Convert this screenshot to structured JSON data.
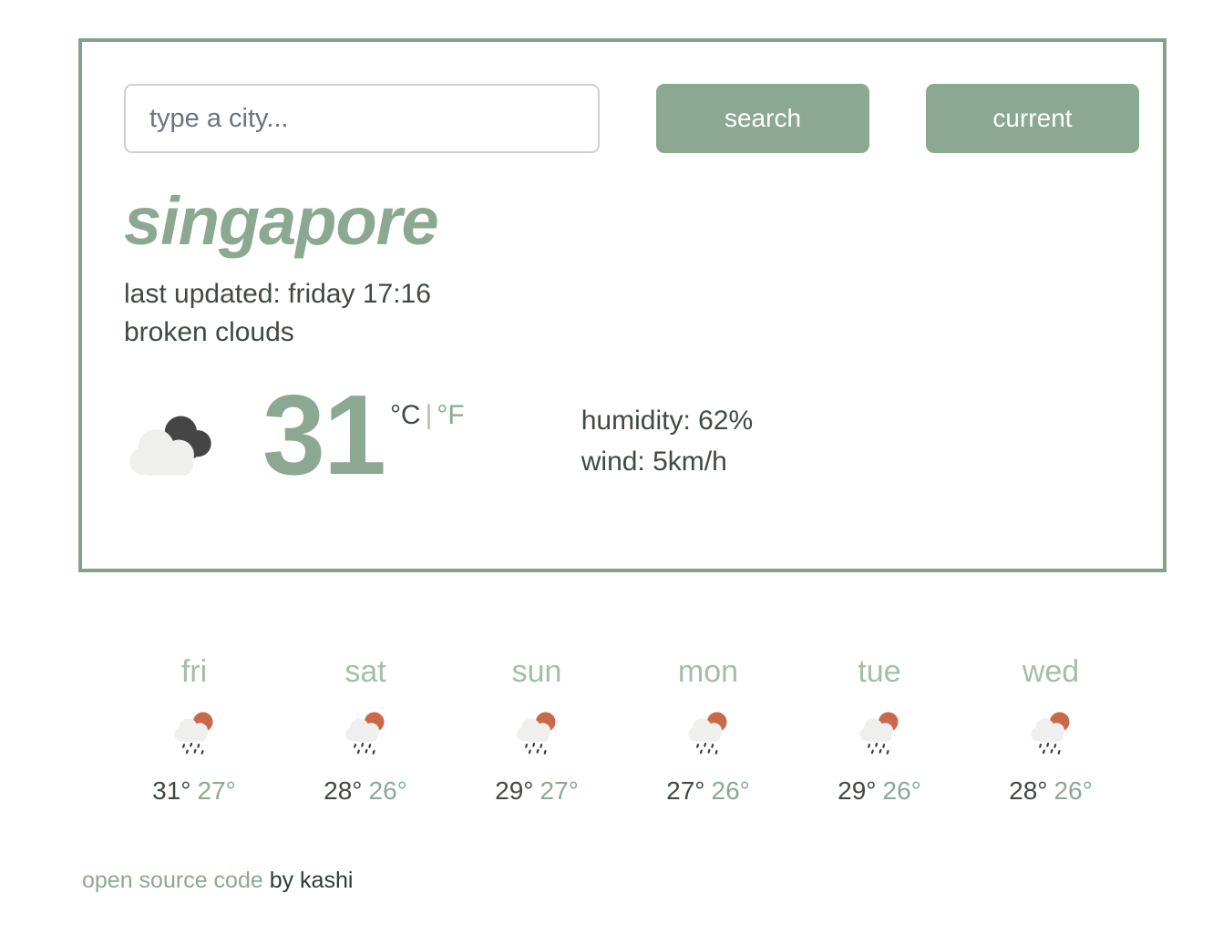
{
  "search": {
    "placeholder": "type a city...",
    "value": "",
    "search_label": "search",
    "current_label": "current"
  },
  "current": {
    "city": "singapore",
    "last_updated": "last updated: friday 17:16",
    "condition": "broken clouds",
    "icon": "broken-clouds-icon",
    "temperature": "31",
    "unit_active": "°C",
    "unit_separator": "|",
    "unit_inactive": "°F",
    "humidity": "humidity: 62%",
    "wind": "wind: 5km/h"
  },
  "forecast": {
    "days": [
      {
        "name": "fri",
        "icon": "rain-sun-icon",
        "high": "31°",
        "low": "27°"
      },
      {
        "name": "sat",
        "icon": "rain-sun-icon",
        "high": "28°",
        "low": "26°"
      },
      {
        "name": "sun",
        "icon": "rain-sun-icon",
        "high": "29°",
        "low": "27°"
      },
      {
        "name": "mon",
        "icon": "rain-sun-icon",
        "high": "27°",
        "low": "26°"
      },
      {
        "name": "tue",
        "icon": "rain-sun-icon",
        "high": "29°",
        "low": "26°"
      },
      {
        "name": "wed",
        "icon": "rain-sun-icon",
        "high": "28°",
        "low": "26°"
      }
    ]
  },
  "footer": {
    "link_text": "open source code",
    "suffix": " by kashi"
  },
  "colors": {
    "accent_green": "#8ba992",
    "border_green": "#82a389",
    "light_green": "#a3bea9",
    "dark_text": "#3f4a42",
    "sun_orange": "#c9694a",
    "cloud_light": "#efefed",
    "cloud_dark": "#454545"
  }
}
